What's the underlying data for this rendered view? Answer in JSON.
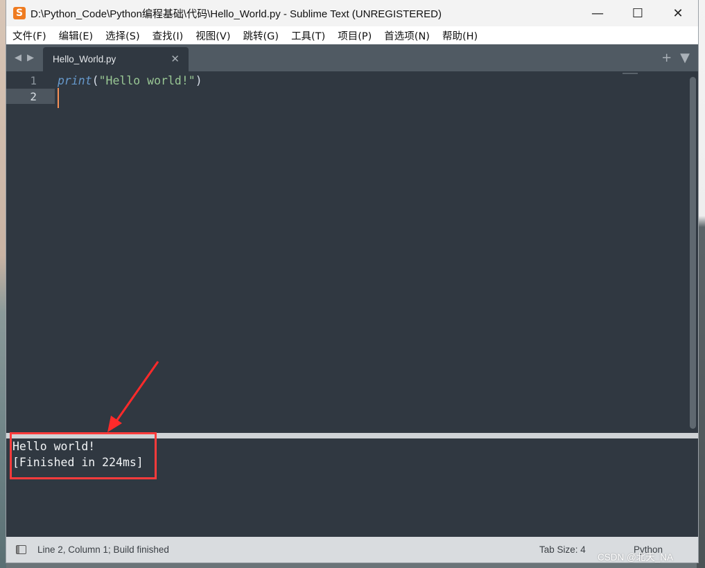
{
  "window": {
    "title": "D:\\Python_Code\\Python编程基础\\代码\\Hello_World.py - Sublime Text (UNREGISTERED)",
    "app_icon_glyph": "S",
    "controls": {
      "minimize": "—",
      "maximize": "☐",
      "close": "✕"
    }
  },
  "menu": {
    "items": [
      "文件(F)",
      "编辑(E)",
      "选择(S)",
      "查找(I)",
      "视图(V)",
      "跳转(G)",
      "工具(T)",
      "项目(P)",
      "首选项(N)",
      "帮助(H)"
    ]
  },
  "tabs": {
    "nav_back": "◀",
    "nav_forward": "▶",
    "active": {
      "label": "Hello_World.py",
      "close": "✕"
    },
    "new_tab": "+",
    "menu": "▼"
  },
  "editor": {
    "lines": [
      {
        "number": "1",
        "kw": "print",
        "open": "(",
        "string": "\"Hello world!\"",
        "close": ")"
      },
      {
        "number": "2"
      }
    ]
  },
  "output": {
    "lines": [
      "Hello world!",
      "[Finished in 224ms]"
    ],
    "highlight_color": "#ff3b3b"
  },
  "status": {
    "position": "Line 2, Column 1; Build finished",
    "tab_size": "Tab Size: 4",
    "syntax": "Python"
  },
  "watermark": "CSDN @北天_NA",
  "colors": {
    "accent": "#ef7b20",
    "editor_bg": "#303841",
    "keyword": "#6699cc",
    "string": "#99c794",
    "caret": "#f99157"
  }
}
